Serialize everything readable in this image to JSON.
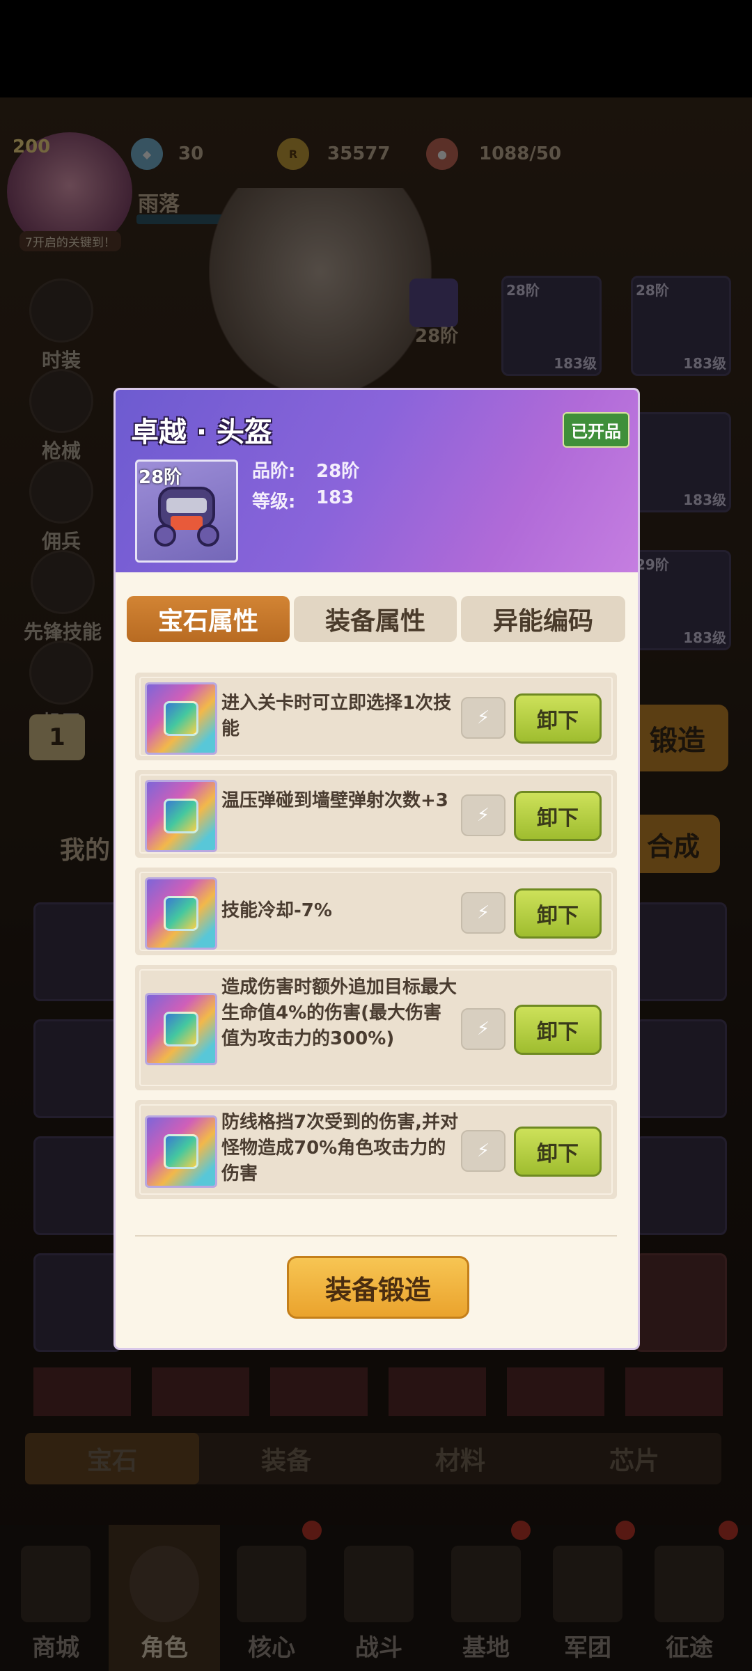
{
  "top_bar": {
    "player_level": "200",
    "avatar_caption": "7开启的关键到！",
    "gem_count": "30",
    "gold": "35577",
    "stamina": "1088/50",
    "player_name": "雨落"
  },
  "side_menu": [
    "时装",
    "枪械",
    "佣兵",
    "先锋技能",
    "机甲"
  ],
  "hero": {
    "tier": "28阶"
  },
  "equip_slots": [
    {
      "tier": "28阶",
      "level": "183级"
    },
    {
      "tier": "28阶",
      "level": "183级"
    },
    {
      "tier": "",
      "level": "183级"
    },
    {
      "tier": "29阶",
      "level": "183级"
    }
  ],
  "bg_labels": {
    "count": "1",
    "forge": "锻造",
    "compose": "合成",
    "my": "我的"
  },
  "bottom_tabs": [
    "宝石",
    "装备",
    "材料",
    "芯片"
  ],
  "nav": [
    "商城",
    "角色",
    "核心",
    "战斗",
    "基地",
    "军团",
    "征途"
  ],
  "modal": {
    "title": "卓越 · 头盔",
    "status_badge": "已开品",
    "item_tier": "28阶",
    "grade_label": "品阶:",
    "grade_value": "28阶",
    "level_label": "等级:",
    "level_value": "183",
    "tabs": [
      "宝石属性",
      "装备属性",
      "异能编码"
    ],
    "gems": [
      {
        "desc": "进入关卡时可立即选择1次技能",
        "button": "卸下"
      },
      {
        "desc": "温压弹碰到墙壁弹射次数+3",
        "button": "卸下"
      },
      {
        "desc": "技能冷却-7%",
        "button": "卸下"
      },
      {
        "desc": "造成伤害时额外追加目标最大生命值4%的伤害(最大伤害值为攻击力的300%)",
        "button": "卸下"
      },
      {
        "desc": "防线格挡7次受到的伤害,并对怪物造成70%角色攻击力的伤害",
        "button": "卸下"
      }
    ],
    "forge_button": "装备锻造"
  }
}
